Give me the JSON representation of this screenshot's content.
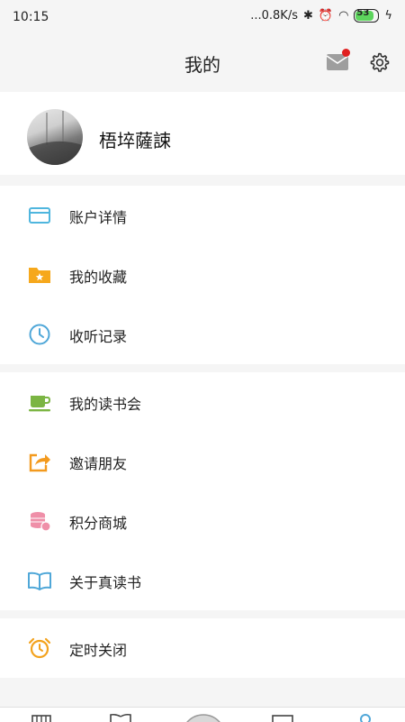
{
  "status_bar": {
    "time": "10:15",
    "network_speed": "...0.8K/s",
    "battery": "53"
  },
  "header": {
    "title": "我的",
    "mail_icon": "mail-icon",
    "settings_icon": "gear-icon"
  },
  "profile": {
    "username": "梧埣薩誎"
  },
  "menu_groups": [
    [
      {
        "label": "账户详情",
        "icon": "card-icon"
      },
      {
        "label": "我的收藏",
        "icon": "folder-star-icon"
      },
      {
        "label": "收听记录",
        "icon": "clock-icon"
      }
    ],
    [
      {
        "label": "我的读书会",
        "icon": "cup-icon"
      },
      {
        "label": "邀请朋友",
        "icon": "share-icon"
      },
      {
        "label": "积分商城",
        "icon": "coins-icon"
      },
      {
        "label": "关于真读书",
        "icon": "book-icon"
      }
    ],
    [
      {
        "label": "定时关闭",
        "icon": "alarm-icon"
      }
    ]
  ],
  "colors": {
    "card": "#4fb6de",
    "folder": "#f6a81c",
    "clock": "#4fa7d8",
    "cup": "#7bb543",
    "share": "#f39a1e",
    "coins": "#ef8fa8",
    "book": "#4fa7d8",
    "alarm": "#f3a21d",
    "badge": "#e02020"
  }
}
